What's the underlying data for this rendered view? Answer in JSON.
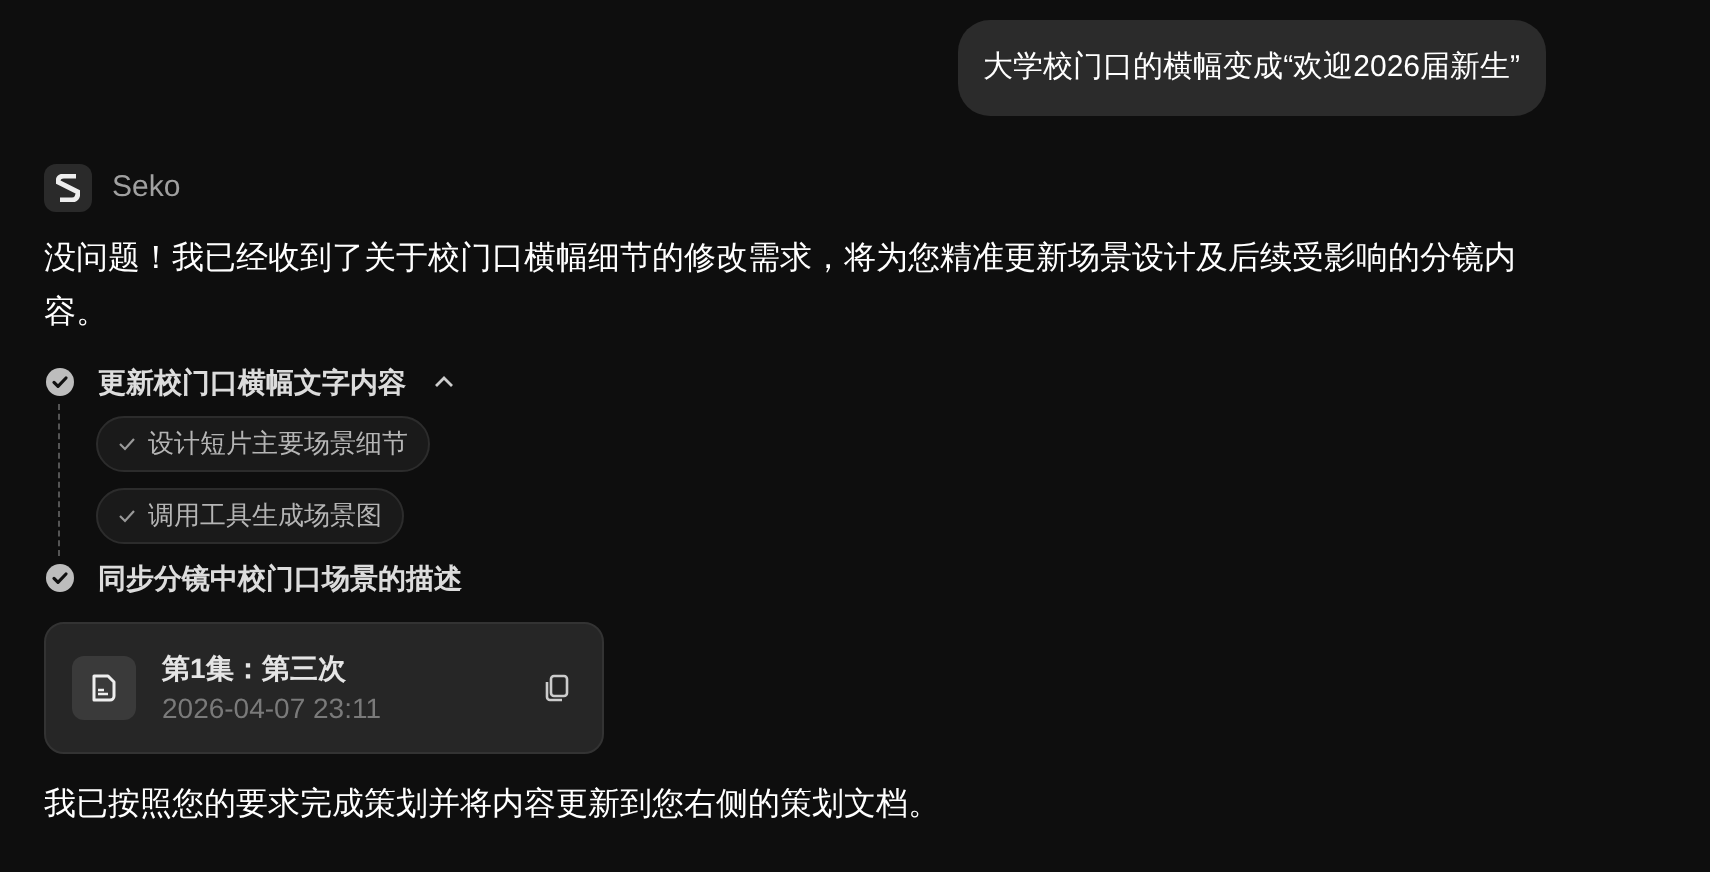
{
  "user_message": "大学校门口的横幅变成“欢迎2026届新生”",
  "assistant": {
    "name": "Seko",
    "intro": "没问题！我已经收到了关于校门口横幅细节的修改需求，将为您精准更新场景设计及后续受影响的分镜内容。",
    "steps": [
      {
        "label": "更新校门口横幅文字内容",
        "done": true,
        "expanded": true,
        "substeps": [
          {
            "label": "设计短片主要场景细节",
            "done": true
          },
          {
            "label": "调用工具生成场景图",
            "done": true
          }
        ]
      },
      {
        "label": "同步分镜中校门口场景的描述",
        "done": true
      }
    ],
    "document": {
      "title": "第1集：第三次",
      "timestamp": "2026-04-07 23:11"
    },
    "outro": "我已按照您的要求完成策划并将内容更新到您右侧的策划文档。"
  }
}
